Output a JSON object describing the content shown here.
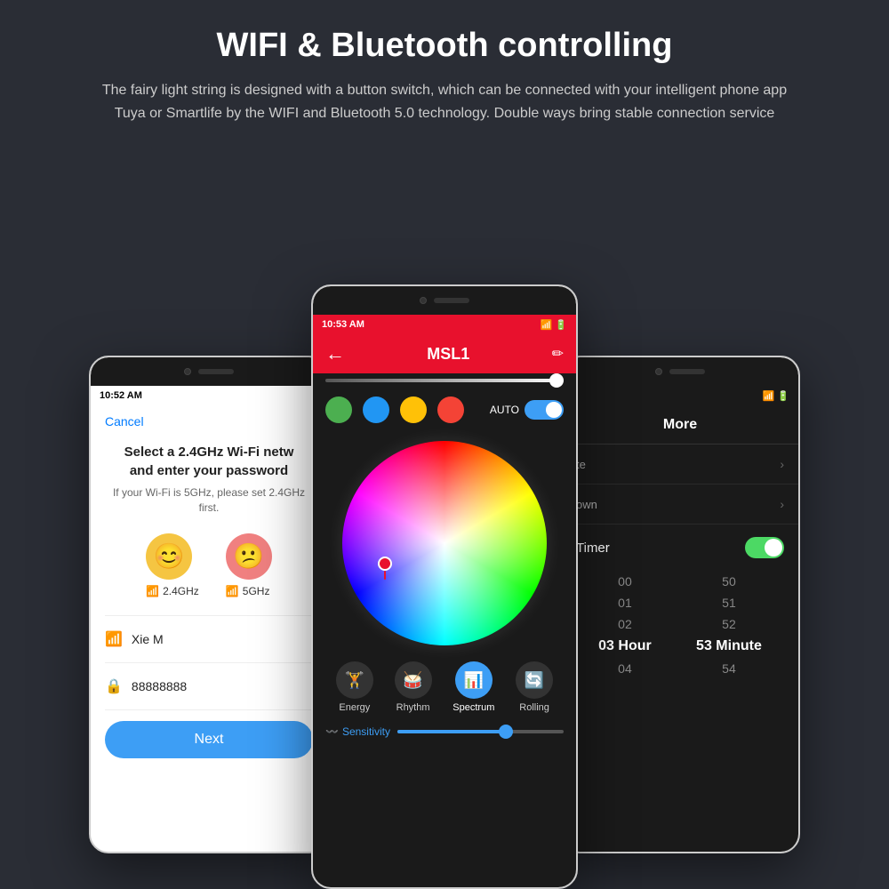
{
  "header": {
    "title": "WIFI & Bluetooth controlling",
    "description": "The fairy light string is designed with a button switch, which can be connected with your intelligent phone app Tuya or Smartlife by the WIFI and Bluetooth 5.0 technology. Double ways bring stable connection service"
  },
  "phone_left": {
    "status_time": "10:52 AM",
    "cancel_label": "Cancel",
    "wifi_title_line1": "Select a 2.4GHz Wi-Fi netw",
    "wifi_title_line2": "and enter your password",
    "wifi_sub": "If your Wi-Fi is 5GHz, please set 2.4GHz first.",
    "freq_24": "2.4GHz",
    "freq_5": "5GHz",
    "network_name": "Xie M",
    "password": "88888888",
    "next_button": "Next"
  },
  "phone_center": {
    "status_time": "10:53 AM",
    "title": "MSL1",
    "auto_label": "AUTO",
    "color_dots": [
      "#4caf50",
      "#2196f3",
      "#ffc107",
      "#f44336"
    ],
    "modes": [
      {
        "label": "Energy",
        "active": false
      },
      {
        "label": "Rhythm",
        "active": false
      },
      {
        "label": "Spectrum",
        "active": true
      },
      {
        "label": "Rolling",
        "active": false
      }
    ],
    "sensitivity_label": "Sensitivity"
  },
  "phone_right": {
    "status_time": "",
    "more_title": "More",
    "menu_items": [
      {
        "label": "te",
        "has_chevron": true
      },
      {
        "label": "own",
        "has_chevron": true
      }
    ],
    "timer_label": "Timer",
    "time_columns": {
      "hours": [
        "00",
        "01",
        "02",
        "03 Hour",
        "04"
      ],
      "minutes": [
        "50",
        "51",
        "52",
        "53 Minute",
        "54"
      ]
    }
  },
  "icons": {
    "back": "←",
    "edit": "✏",
    "chevron": "›",
    "wifi": "📶",
    "lock": "🔒",
    "signal": "📶"
  }
}
